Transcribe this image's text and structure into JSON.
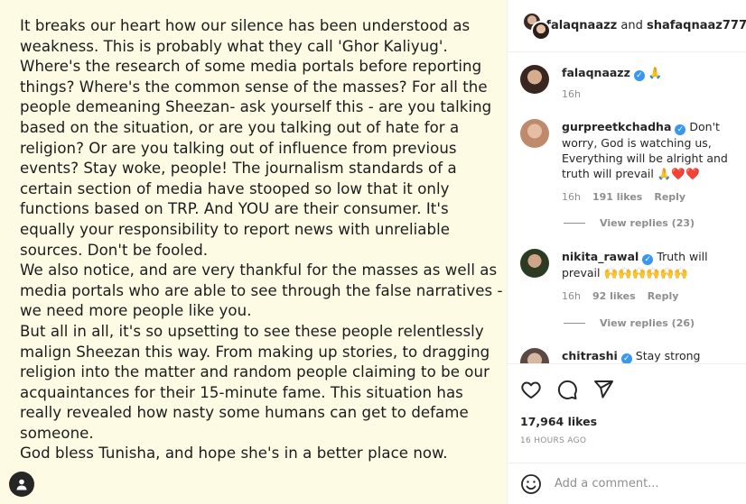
{
  "post": {
    "paragraphs": [
      "It breaks our heart how our silence has been understood as weakness. This is probably what they call 'Ghor Kaliyug'. Where's the research of some media portals before reporting things? Where's the common sense of the masses? For all the people demeaning Sheezan- ask yourself this - are you talking based on the situation, or are you talking out of hate for a religion? Or are you talking out of influence from previous events? Stay woke, people! The journalism standards of a certain section of media have stooped so low that it only functions based on TRP. And YOU are their consumer. It's equally your responsibility to report news with unreliable sources. Don't be fooled.",
      "We also notice, and are very thankful for the masses as well as media portals who are able to see through the false narratives - we need more people like you.",
      "But all in all, it's so upsetting to see these people relentlessly malign Sheezan this way. From making up stories, to dragging religion into the matter and random people claiming to be our acquaintances for their 15-minute fame. This situation has really revealed how nasty some humans can get to defame someone.",
      "God bless Tunisha, and hope she's in a better place now."
    ]
  },
  "header": {
    "user1": "falaqnaazz",
    "joiner": " and ",
    "user2": "shafaqnaaz777"
  },
  "caption": {
    "user": "falaqnaazz",
    "text": "🙏",
    "time": "16h"
  },
  "comments": [
    {
      "user": "gurpreetkchadha",
      "text": "Don't worry, God is watching us, Everything will be alright and truth will prevail 🙏❤️❤️",
      "time": "16h",
      "likes": "191 likes",
      "reply": "Reply",
      "view_replies": "View replies (23)"
    },
    {
      "user": "nikita_rawal",
      "text": "Truth will prevail 🙌🙌🙌🙌🙌🙌",
      "time": "16h",
      "likes": "92 likes",
      "reply": "Reply",
      "view_replies": "View replies (26)"
    },
    {
      "user": "chitrashi",
      "text": "Stay strong baby 🙏"
    }
  ],
  "stats": {
    "likes": "17,964 likes",
    "time": "16 HOURS AGO"
  },
  "composer": {
    "placeholder": "Add a comment..."
  },
  "icons": {
    "like": "heart-icon",
    "comment": "comment-icon",
    "share": "share-icon",
    "emoji": "emoji-icon",
    "tag": "user-tag-icon"
  }
}
